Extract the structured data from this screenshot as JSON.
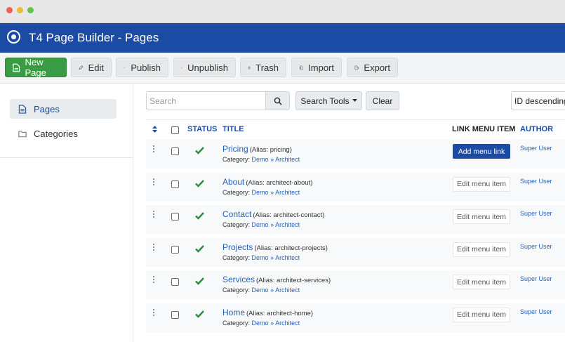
{
  "window": {
    "title": "T4 Page Builder - Pages"
  },
  "toolbar": {
    "new_page": "New Page",
    "edit": "Edit",
    "publish": "Publish",
    "unpublish": "Unpublish",
    "trash": "Trash",
    "import": "Import",
    "export": "Export"
  },
  "sidebar": {
    "items": [
      {
        "label": "Pages",
        "active": true
      },
      {
        "label": "Categories",
        "active": false
      }
    ]
  },
  "filters": {
    "search_placeholder": "Search",
    "search_tools": "Search Tools",
    "clear": "Clear",
    "ordering": "ID descending"
  },
  "table": {
    "columns": {
      "status": "STATUS",
      "title": "TITLE",
      "link_menu_item": "LINK MENU ITEM",
      "author": "AUTHOR"
    },
    "category_label": "Category:",
    "rows": [
      {
        "title": "Pricing",
        "alias": "(Alias: pricing)",
        "category_parent": "Demo",
        "sep": "»",
        "category": "Architect",
        "menu_action": "Add menu link",
        "menu_primary": true,
        "author": "Super User"
      },
      {
        "title": "About",
        "alias": "(Alias: architect-about)",
        "category_parent": "Demo",
        "sep": "»",
        "category": "Architect",
        "menu_action": "Edit menu item",
        "menu_primary": false,
        "author": "Super User"
      },
      {
        "title": "Contact",
        "alias": "(Alias: architect-contact)",
        "category_parent": "Demo",
        "sep": "»",
        "category": "Architect",
        "menu_action": "Edit menu item",
        "menu_primary": false,
        "author": "Super User"
      },
      {
        "title": "Projects",
        "alias": "(Alias: architect-projects)",
        "category_parent": "Demo",
        "sep": "»",
        "category": "Architect",
        "menu_action": "Edit menu item",
        "menu_primary": false,
        "author": "Super User"
      },
      {
        "title": "Services",
        "alias": "(Alias: architect-services)",
        "category_parent": "Demo",
        "sep": "»",
        "category": "Architect",
        "menu_action": "Edit menu item",
        "menu_primary": false,
        "author": "Super User"
      },
      {
        "title": "Home",
        "alias": "(Alias: architect-home)",
        "category_parent": "Demo",
        "sep": "»",
        "category": "Architect",
        "menu_action": "Edit menu item",
        "menu_primary": false,
        "author": "Super User"
      }
    ]
  },
  "colors": {
    "brand": "#1c4ba6",
    "success": "#3a9b45",
    "link": "#2762b8",
    "check": "#2e8b3c"
  }
}
